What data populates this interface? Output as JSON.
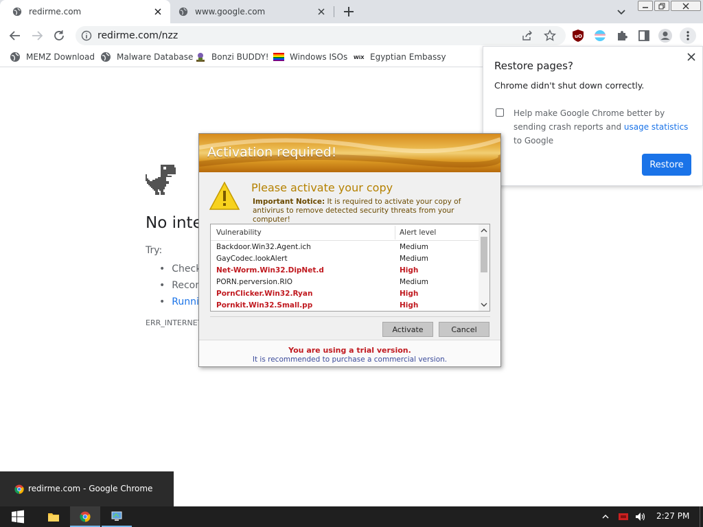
{
  "browser": {
    "tabs": [
      {
        "title": "redirme.com",
        "active": true
      },
      {
        "title": "www.google.com",
        "active": false
      }
    ],
    "address": "redirme.com/nzz",
    "bookmarks": [
      "MEMZ Download",
      "Malware Database",
      "Bonzi BUDDY!",
      "Windows ISOs",
      "Egyptian Embassy"
    ]
  },
  "error_page": {
    "title": "No inte",
    "try_label": "Try:",
    "suggestions": [
      "Check",
      "Recon",
      "Runni"
    ],
    "code": "ERR_INTERNET"
  },
  "restore_bubble": {
    "title": "Restore pages?",
    "message": "Chrome didn't shut down correctly.",
    "help_text_1": "Help make Google Chrome better by sending crash reports and ",
    "help_link": "usage statistics",
    "help_text_2": " to Google",
    "button": "Restore"
  },
  "av_dialog": {
    "header": "Activation required!",
    "subtitle": "Please activate your copy",
    "notice_label": "Important Notice:",
    "notice_text": " It is required to activate your copy of antivirus to remove detected security threats from your computer!",
    "columns": [
      "Vulnerability",
      "Alert level"
    ],
    "rows": [
      {
        "name": "Backdoor.Win32.Agent.ich",
        "level": "Medium"
      },
      {
        "name": "GayCodec.lookAlert",
        "level": "Medium"
      },
      {
        "name": "Net-Worm.Win32.DipNet.d",
        "level": "High"
      },
      {
        "name": "PORN.perversion.RIO",
        "level": "Medium"
      },
      {
        "name": "PornClicker.Win32.Ryan",
        "level": "High"
      },
      {
        "name": "Pornkit.Win32.Small.pp",
        "level": "High"
      }
    ],
    "activate_button": "Activate",
    "cancel_button": "Cancel",
    "footer_line1": "You are using a trial version.",
    "footer_line2": "It is recommended to purchase a commercial version."
  },
  "taskbar": {
    "preview_title": "redirme.com - Google Chrome",
    "clock": "2:27 PM"
  },
  "colors": {
    "chrome_blue": "#1a73e8",
    "alert_red": "#c0191f",
    "av_gold": "#e9b64a"
  }
}
